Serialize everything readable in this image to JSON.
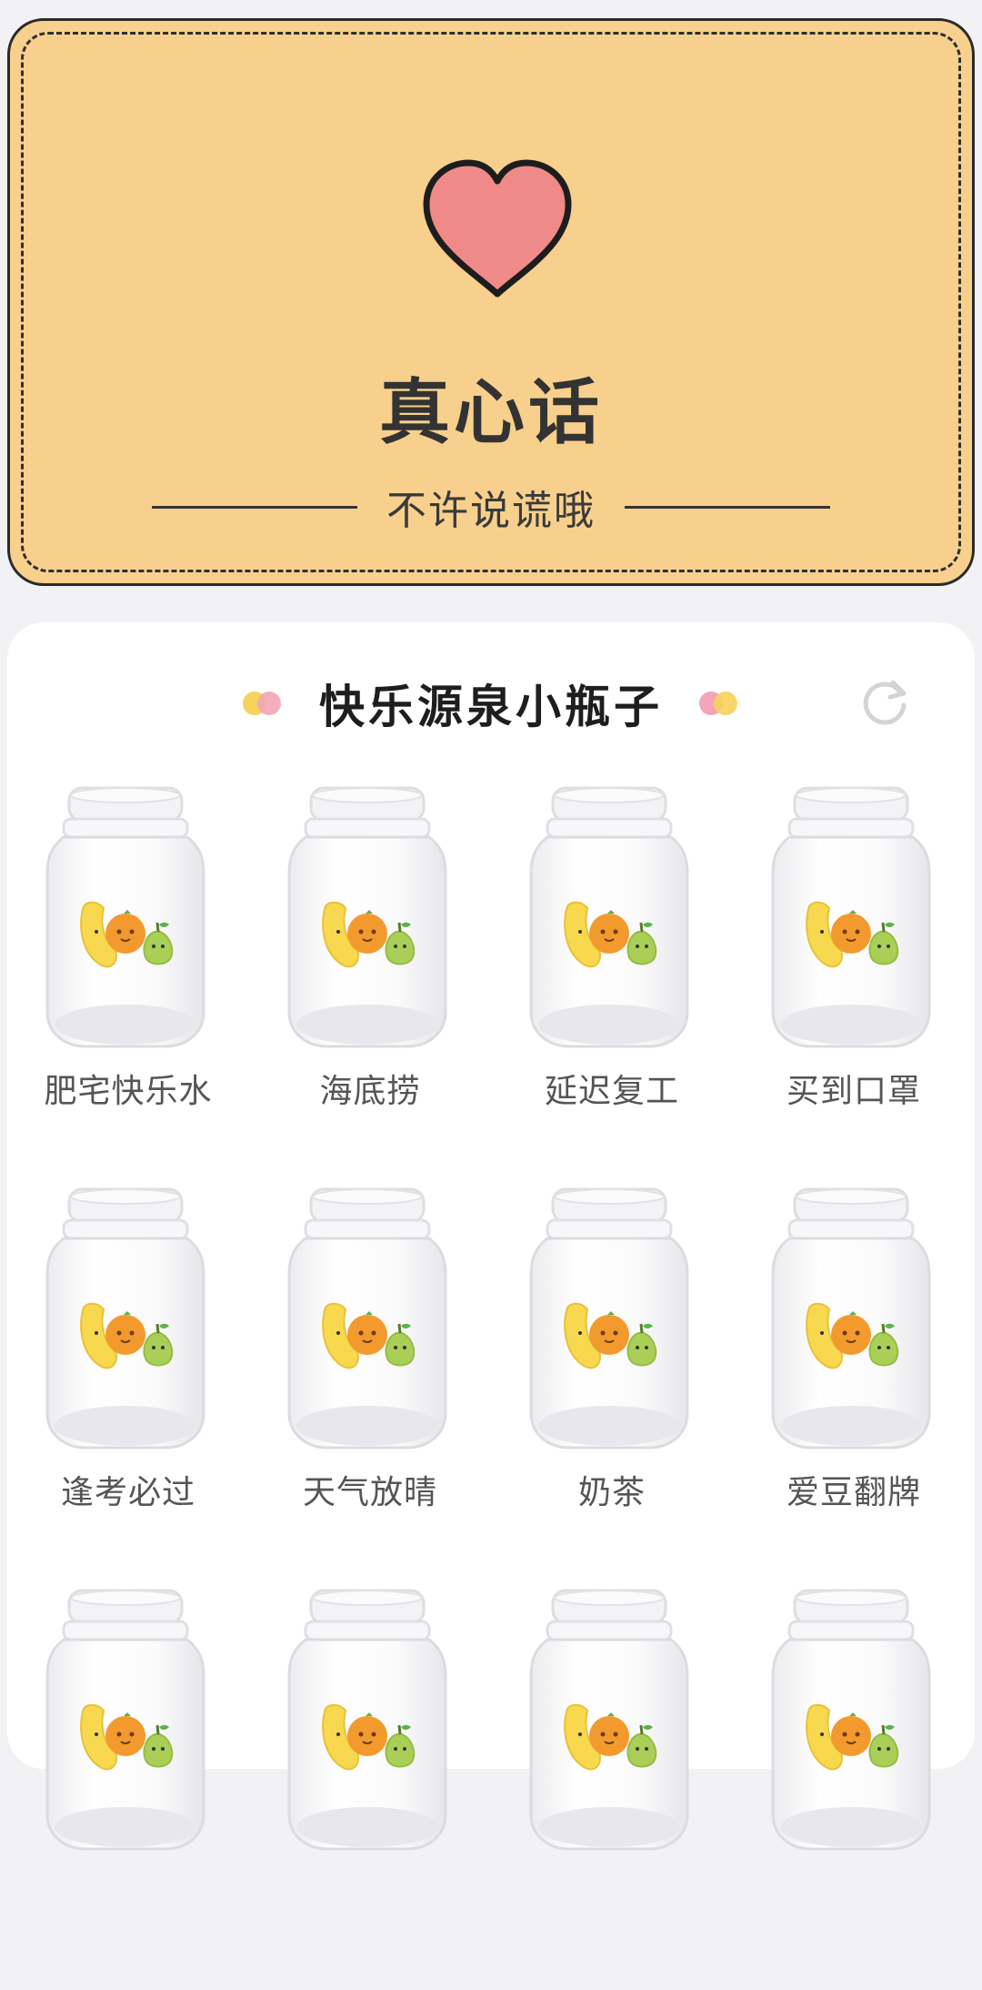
{
  "truth_card": {
    "title": "真心话",
    "subtitle": "不许说谎哦",
    "background": "#f8d08d",
    "heart_color": "#f08a88",
    "icon": "heart-icon"
  },
  "jar_panel": {
    "title": "快乐源泉小瓶子",
    "left_dots": [
      "#f6d35a",
      "#f2a6b8"
    ],
    "right_dots": [
      "#f2a6b8",
      "#f6d35a"
    ],
    "refresh_icon": "refresh-icon",
    "jars": [
      {
        "label": "肥宅快乐水"
      },
      {
        "label": "海底捞"
      },
      {
        "label": "延迟复工"
      },
      {
        "label": "买到口罩"
      },
      {
        "label": "逢考必过"
      },
      {
        "label": "天气放晴"
      },
      {
        "label": "奶茶"
      },
      {
        "label": "爱豆翻牌"
      },
      {
        "label": ""
      },
      {
        "label": ""
      },
      {
        "label": ""
      },
      {
        "label": ""
      }
    ]
  }
}
